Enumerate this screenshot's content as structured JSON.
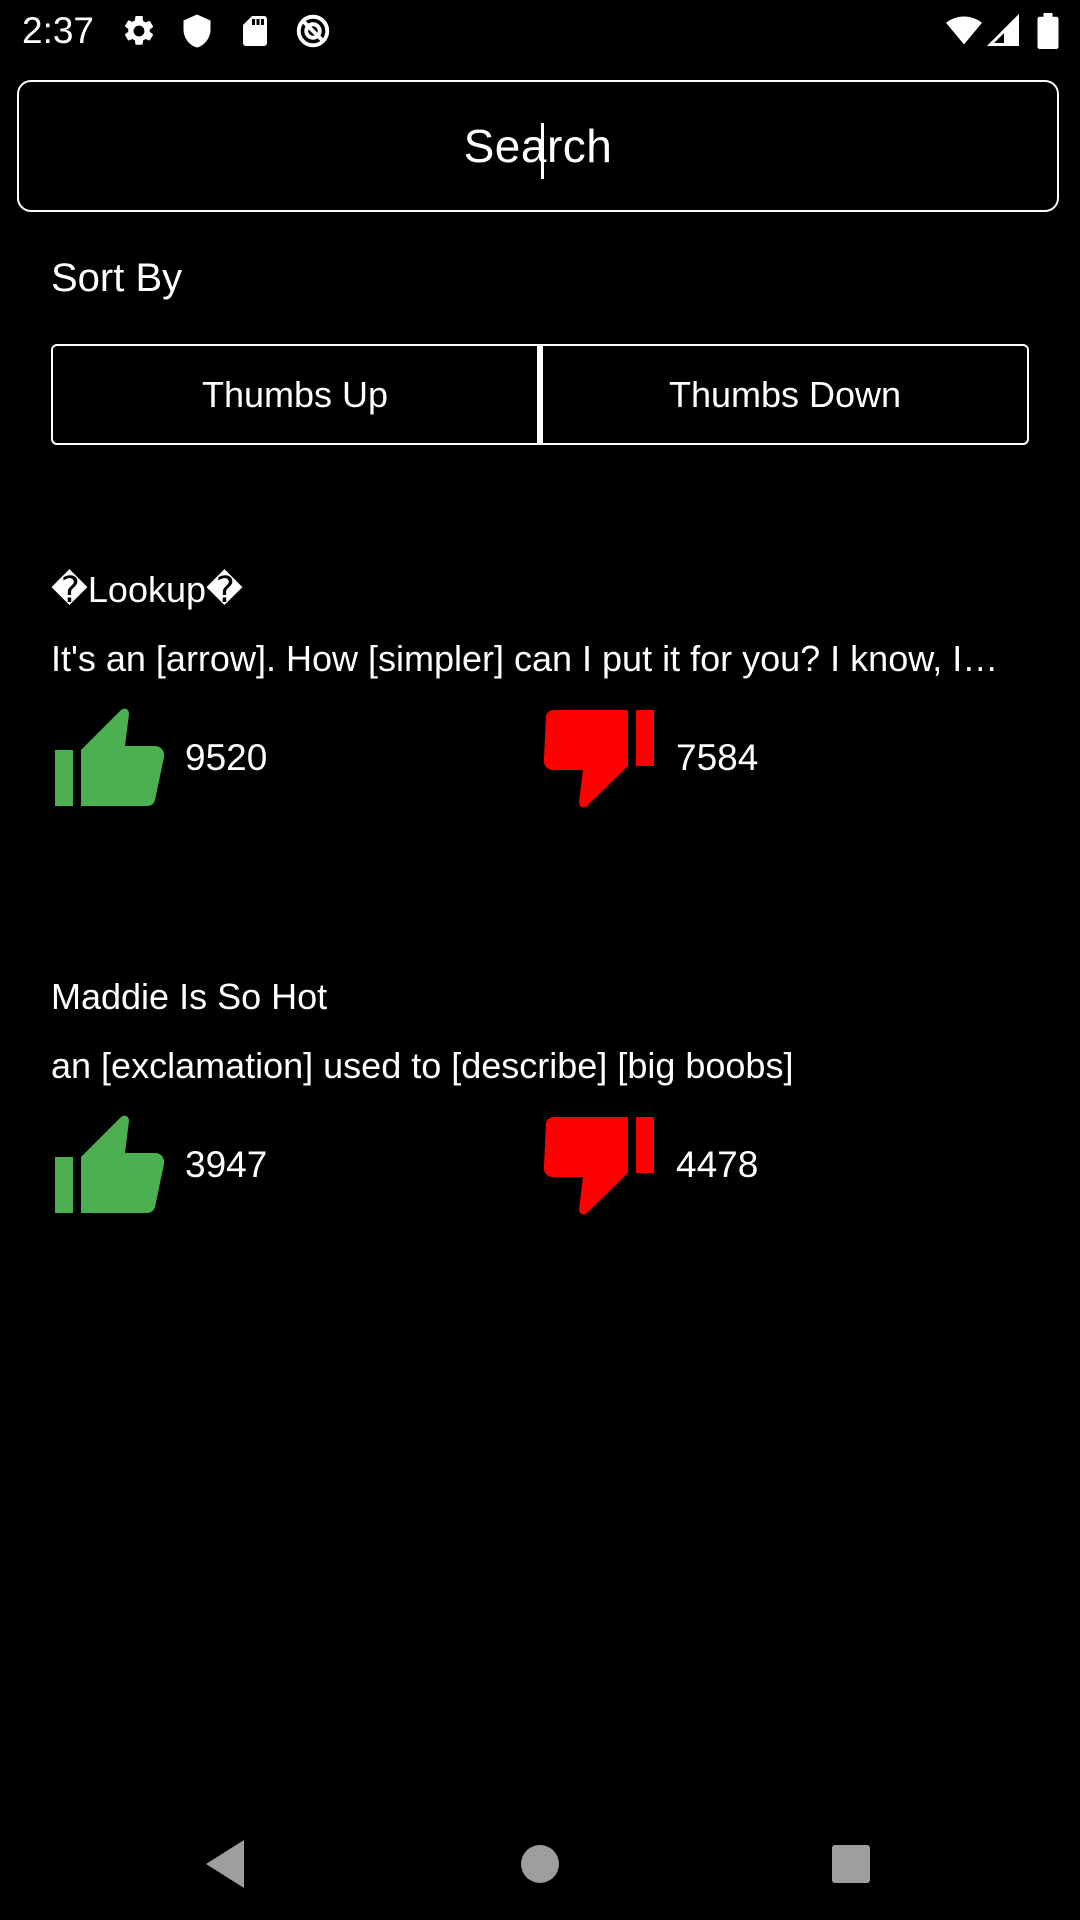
{
  "status_bar": {
    "time": "2:37",
    "left_icons": [
      "gear-icon",
      "shield-icon",
      "sd-card-icon",
      "no-sync-icon"
    ],
    "right_icons": [
      "wifi-icon",
      "signal-icon",
      "battery-icon"
    ]
  },
  "search": {
    "placeholder": "Search"
  },
  "sort": {
    "label": "Sort By",
    "options": [
      "Thumbs Up",
      "Thumbs Down"
    ]
  },
  "entries": [
    {
      "title": "�Lookup�",
      "definition": "It's an [arrow]. How [simpler] can I put it for you? I know, I…",
      "thumbs_up": "9520",
      "thumbs_down": "7584"
    },
    {
      "title": "Maddie Is So Hot",
      "definition": "an [exclamation] used to [describe] [big boobs]",
      "thumbs_up": "3947",
      "thumbs_down": "4478"
    }
  ],
  "colors": {
    "background": "#000000",
    "text": "#ffffff",
    "thumbs_up": "#4caf50",
    "thumbs_down": "#ff0000",
    "nav_icons": "#9e9e9e"
  },
  "nav_bar": {
    "icons": [
      "back-icon",
      "home-icon",
      "recents-icon"
    ]
  }
}
